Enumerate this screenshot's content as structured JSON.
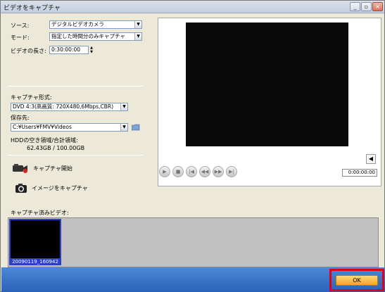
{
  "window": {
    "title": "ビデオをキャプチャ",
    "btn_min": "_",
    "btn_max": "▫",
    "btn_close": "×"
  },
  "settings": {
    "source_label": "ソース:",
    "source_value": "デジタルビデオカメラ",
    "mode_label": "モード:",
    "mode_value": "指定した時間分のみキャプチャ",
    "length_label": "ビデオの長さ:",
    "length_value": "0:30:00:00",
    "format_label": "キャプチャ形式:",
    "format_value": "DVD 4:3(高画質: 720X480,6Mbps,CBR)",
    "save_label": "保存先:",
    "save_value": "C:¥Users¥FMV¥Videos",
    "hdd_label": "HDDの空き領域/合計領域:",
    "hdd_value": "62.43GB / 100.00GB"
  },
  "actions": {
    "capture_start": "キャプチャ開始",
    "capture_image": "イメージをキャプチャ"
  },
  "player": {
    "timecode": "0:00:00:00",
    "play": "▶",
    "stop": "■",
    "start": "|◀",
    "rewind": "◀◀",
    "forward": "▶▶",
    "end": "▶|",
    "volume": "◀"
  },
  "captured": {
    "label": "キャプチャ済みビデオ:",
    "items": [
      {
        "name": "20090119_160942"
      }
    ]
  },
  "footer": {
    "ok_label": "OK"
  },
  "colors": {
    "highlight": "#e0001a",
    "thumb_border": "#2b3fc8",
    "ok_button": "#f1a523",
    "bottom_bar": "#2a62b8"
  }
}
